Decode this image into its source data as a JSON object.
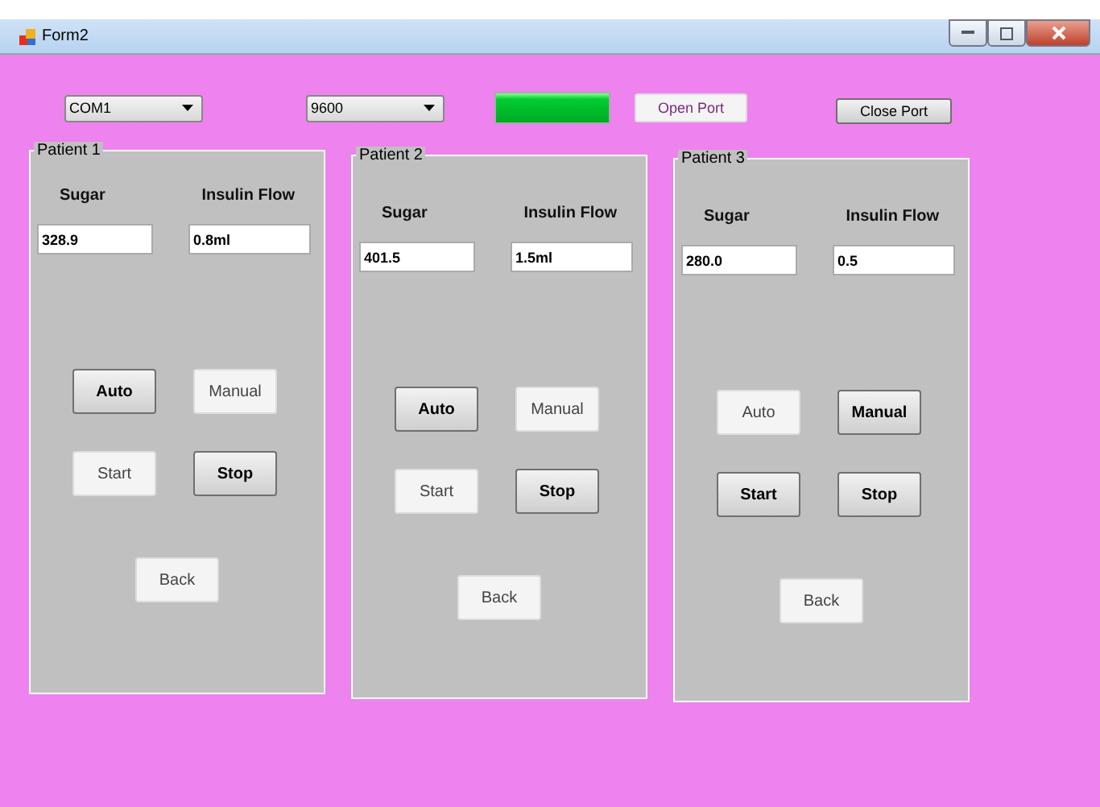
{
  "window": {
    "title": "Form2"
  },
  "toolbar": {
    "port": "COM1",
    "baud": "9600",
    "connection": {
      "level": 1
    },
    "buttons": [
      {
        "label": "Open Port",
        "disabled": true
      },
      {
        "label": "Close Port",
        "disabled": false
      }
    ]
  },
  "patients": [
    {
      "title": "Patient 1",
      "sugar_label": "Sugar",
      "flow_label": "Insulin Flow",
      "sugar": "328.9",
      "flow": "0.8ml",
      "buttons": [
        {
          "label": "Auto",
          "disabled": false
        },
        {
          "label": "Manual",
          "disabled": true
        },
        {
          "label": "Start",
          "disabled": true
        },
        {
          "label": "Stop",
          "disabled": false
        }
      ],
      "back": {
        "label": "Back",
        "disabled": true
      }
    },
    {
      "title": "Patient 2",
      "sugar_label": "Sugar",
      "flow_label": "Insulin Flow",
      "sugar": "401.5",
      "flow": "1.5ml",
      "buttons": [
        {
          "label": "Auto",
          "disabled": false
        },
        {
          "label": "Manual",
          "disabled": true
        },
        {
          "label": "Start",
          "disabled": true
        },
        {
          "label": "Stop",
          "disabled": false
        }
      ],
      "back": {
        "label": "Back",
        "disabled": true
      }
    },
    {
      "title": "Patient 3",
      "sugar_label": "Sugar",
      "flow_label": "Insulin Flow",
      "sugar": "280.0",
      "flow": "0.5",
      "buttons": [
        {
          "label": "Auto",
          "disabled": true
        },
        {
          "label": "Manual",
          "disabled": false
        },
        {
          "label": "Start",
          "disabled": false
        },
        {
          "label": "Stop",
          "disabled": false
        }
      ],
      "back": {
        "label": "Back",
        "disabled": true
      }
    }
  ]
}
